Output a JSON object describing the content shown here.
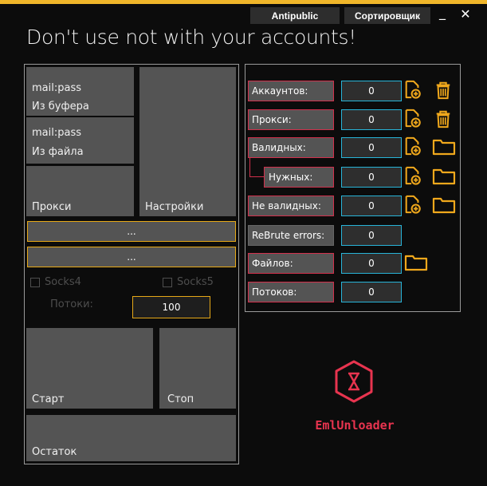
{
  "window": {
    "title": "Don't use not with your accounts!",
    "tabs": [
      {
        "label": "Antipublic"
      },
      {
        "label": "Сортировщик"
      }
    ],
    "minimize_glyph": "_",
    "close_glyph": "✕",
    "accent_color": "#f0b62a"
  },
  "left": {
    "tiles": {
      "clipboard": {
        "line1": "mail:pass",
        "line2": "Из буфера"
      },
      "file": {
        "line1": "mail:pass",
        "line2": "Из файла"
      },
      "proxy": "Прокси",
      "settings": "Настройки"
    },
    "bar1": "...",
    "bar2": "...",
    "socks4": "Socks4",
    "socks5": "Socks5",
    "threads_label": "Потоки:",
    "threads_value": "100",
    "start": "Старт",
    "stop": "Стоп",
    "remainder": "Остаток"
  },
  "stats": [
    {
      "label": "Аккаунтов:",
      "value": "0",
      "icons": [
        "file-add-icon",
        "trash-icon"
      ]
    },
    {
      "label": "Прокси:",
      "value": "0",
      "icons": [
        "file-add-icon",
        "trash-icon"
      ]
    },
    {
      "label": "Валидных:",
      "value": "0",
      "icons": [
        "file-add-icon",
        "folder-icon"
      ]
    },
    {
      "label": "Нужных:",
      "value": "0",
      "icons": [
        "file-add-icon",
        "folder-icon"
      ]
    },
    {
      "label": "Не валидных:",
      "value": "0",
      "icons": [
        "file-add-icon",
        "folder-icon"
      ]
    },
    {
      "label": "ReBrute errors:",
      "value": "0",
      "icons": []
    },
    {
      "label": "Файлов:",
      "value": "0",
      "icons": [
        "folder-icon"
      ]
    },
    {
      "label": "Потоков:",
      "value": "0",
      "icons": []
    }
  ],
  "logo": {
    "text": "EmlUnloader",
    "color": "#e8344f"
  },
  "colors": {
    "icon": "#f0a81c",
    "label_border": "#d1304c",
    "value_border": "#28b4d8"
  }
}
